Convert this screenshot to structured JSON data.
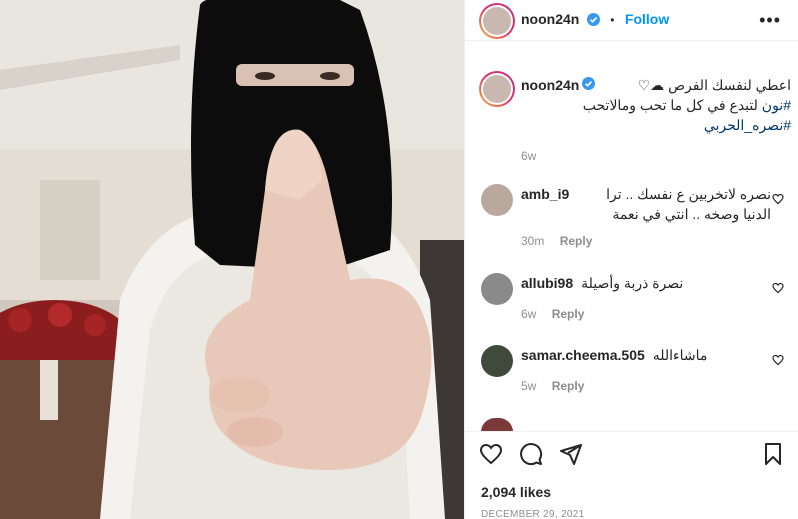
{
  "post": {
    "username": "noon24n",
    "follow_label": "Follow",
    "separator": "•",
    "more_label": "•••"
  },
  "caption": {
    "username": "noon24n",
    "text_line1": "اعطي لنفسك الفرص ☁♡",
    "text_line2": "لتبدع في كل ما تحب ومالاتحب",
    "hashtag1": "#نون",
    "hashtag2": "#نصره_الحربي",
    "time": "6w"
  },
  "comments": [
    {
      "username": "amb_i9",
      "text_line1": "نصره لاتخربين ع نفسك .. ترا",
      "text_line2": "الدنيا وصخه .. انتي في نعمة",
      "time": "30m",
      "reply": "Reply"
    },
    {
      "username": "allubi98",
      "text_line1": "نصرة ذربة وأصيلة",
      "time": "6w",
      "reply": "Reply"
    },
    {
      "username": "samar.cheema.505",
      "text_line1": "ماشاءالله",
      "time": "5w",
      "reply": "Reply"
    }
  ],
  "footer": {
    "likes": "2,094 likes",
    "date": "DECEMBER 29, 2021"
  },
  "colors": {
    "accent": "#0095f6",
    "hashtag": "#00376b",
    "muted": "#8e8e8e"
  },
  "icons": [
    "verified-badge-icon",
    "more-options-icon",
    "heart-icon",
    "comment-icon",
    "share-icon",
    "bookmark-icon"
  ]
}
